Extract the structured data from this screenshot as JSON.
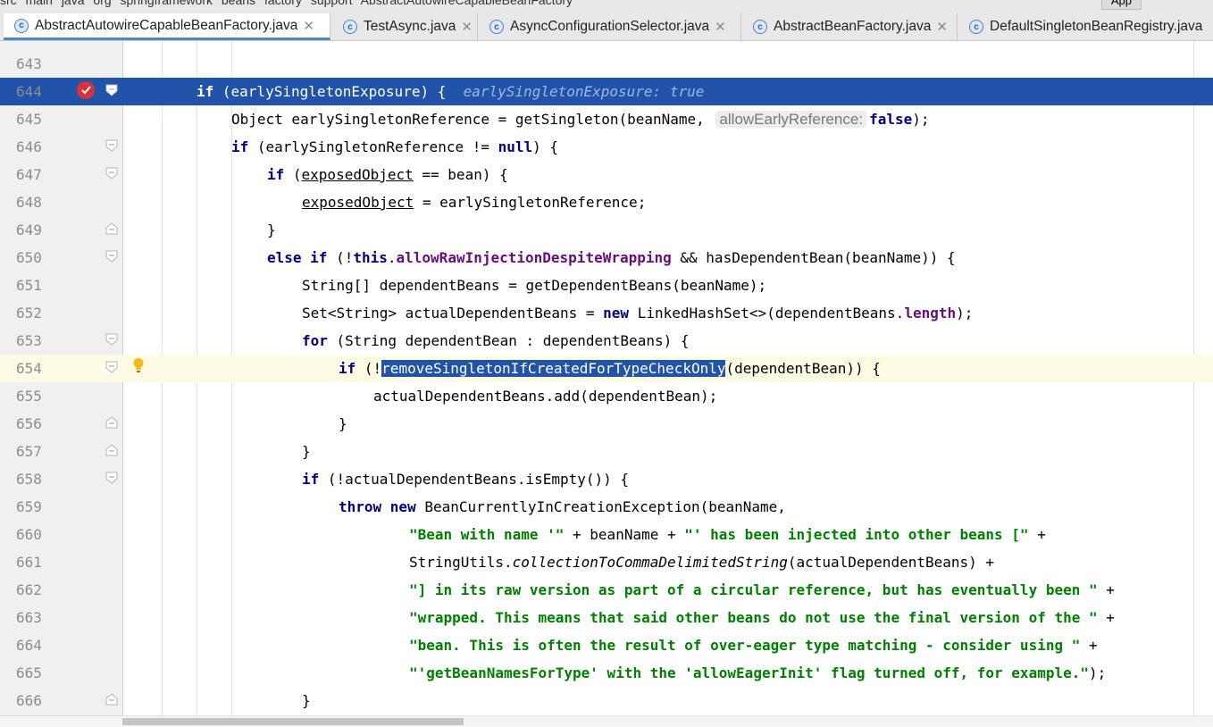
{
  "breadcrumb": {
    "items": [
      "src",
      "main",
      "java",
      "org",
      "springframework",
      "beans",
      "factory",
      "support",
      "AbstractAutowireCapableBeanFactory"
    ],
    "run_config": "App"
  },
  "tabs": [
    {
      "label": "AbstractAutowireCapableBeanFactory.java",
      "active": true,
      "closable": true
    },
    {
      "label": "TestAsync.java",
      "active": false,
      "closable": true
    },
    {
      "label": "AsyncConfigurationSelector.java",
      "active": false,
      "closable": true
    },
    {
      "label": "AbstractBeanFactory.java",
      "active": false,
      "closable": true
    },
    {
      "label": "DefaultSingletonBeanRegistry.java",
      "active": false,
      "closable": false
    }
  ],
  "icons": {
    "class_file": "class-c-icon",
    "close": "close-icon",
    "breakpoint": "breakpoint-icon",
    "intention": "lightbulb-icon"
  },
  "colors": {
    "selection": "#2154a8",
    "keyword": "#000080",
    "field": "#660e7a",
    "string": "#008000",
    "current_line": "#fdfbe3",
    "breakpoint": "#d9323b"
  },
  "editor": {
    "lines": [
      {
        "num": "643"
      },
      {
        "num": "644",
        "selected": true,
        "breakpoint": true,
        "kw": "if",
        "text": " (earlySingletonExposure) {",
        "debug_value": "earlySingletonExposure: true"
      },
      {
        "num": "645",
        "a": "Object earlySingletonReference = getSingleton(beanName, ",
        "hint": "allowEarlyReference:",
        "kw": "false",
        "b": ");"
      },
      {
        "num": "646",
        "kw": "if",
        "a": " (earlySingletonReference != ",
        "kw2": "null",
        "b": ") {"
      },
      {
        "num": "647",
        "kw": "if",
        "a": " (",
        "u": "exposedObject",
        "b": " == bean) {"
      },
      {
        "num": "648",
        "u": "exposedObject",
        "b": " = earlySingletonReference;"
      },
      {
        "num": "649",
        "text": "}"
      },
      {
        "num": "650",
        "kw": "else if",
        "a": " (!",
        "kw2": "this",
        "dot": ".",
        "fld": "allowRawInjectionDespiteWrapping",
        "b": " && hasDependentBean(beanName)) {"
      },
      {
        "num": "651",
        "text": "String[] dependentBeans = getDependentBeans(beanName);"
      },
      {
        "num": "652",
        "a": "Set<String> actualDependentBeans = ",
        "kw": "new",
        "b": " LinkedHashSet<>(dependentBeans.",
        "fld": "length",
        "c": ");"
      },
      {
        "num": "653",
        "kw": "for",
        "text": " (String dependentBean : dependentBeans) {"
      },
      {
        "num": "654",
        "current": true,
        "intention": true,
        "kw": "if",
        "a": " (!",
        "occ": "removeSingletonIfCreatedForTypeCheckOnly",
        "b": "(dependentBean)) {"
      },
      {
        "num": "655",
        "text": "actualDependentBeans.add(dependentBean);"
      },
      {
        "num": "656",
        "text": "}"
      },
      {
        "num": "657",
        "text": "}"
      },
      {
        "num": "658",
        "kw": "if",
        "text": " (!actualDependentBeans.isEmpty()) {"
      },
      {
        "num": "659",
        "kw": "throw new",
        "text": " BeanCurrentlyInCreationException(beanName,"
      },
      {
        "num": "660",
        "str": "\"Bean with name '\"",
        "a": " + beanName + ",
        "str2": "\"' has been injected into other beans [\"",
        "b": " +"
      },
      {
        "num": "661",
        "a": "StringUtils.",
        "it": "collectionToCommaDelimitedString",
        "b": "(actualDependentBeans) +"
      },
      {
        "num": "662",
        "str": "\"] in its raw version as part of a circular reference, but has eventually been \"",
        "b": " +"
      },
      {
        "num": "663",
        "str": "\"wrapped. This means that said other beans do not use the final version of the \"",
        "b": " +"
      },
      {
        "num": "664",
        "str": "\"bean. This is often the result of over-eager type matching - consider using \"",
        "b": " +"
      },
      {
        "num": "665",
        "str": "\"'getBeanNamesForType' with the 'allowEagerInit' flag turned off, for example.\"",
        "b": ");"
      },
      {
        "num": "666",
        "text": "}"
      }
    ]
  }
}
